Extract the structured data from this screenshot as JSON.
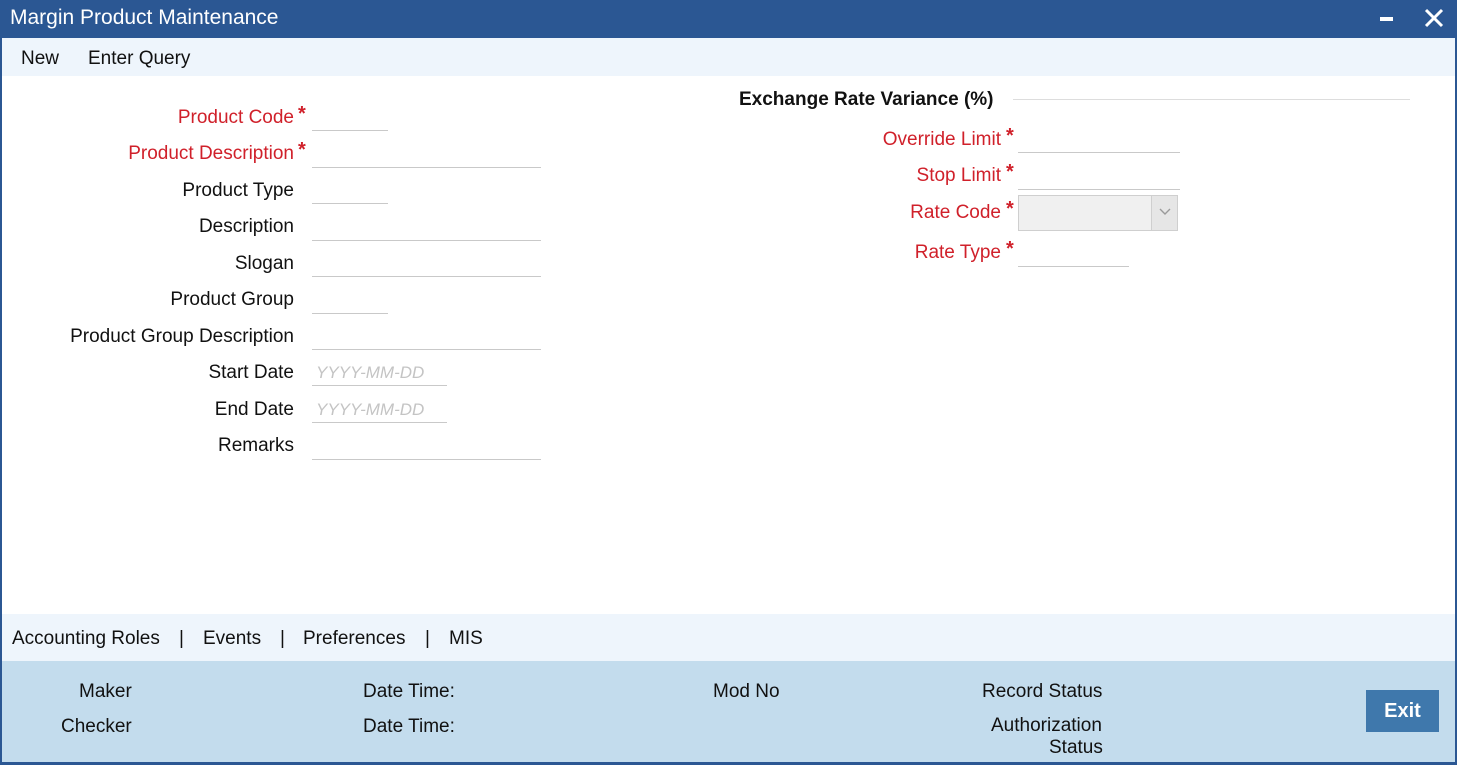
{
  "window": {
    "title": "Margin Product Maintenance",
    "controls": {
      "minimize": "minimize-icon",
      "close": "close-icon"
    },
    "accent_color": "#2b5793"
  },
  "toolbar": {
    "new_label": "New",
    "enter_query_label": "Enter Query"
  },
  "form_left": {
    "product_code": {
      "label": "Product Code",
      "required": true,
      "value": ""
    },
    "product_description": {
      "label": "Product Description",
      "required": true,
      "value": ""
    },
    "product_type": {
      "label": "Product Type",
      "value": ""
    },
    "description": {
      "label": "Description",
      "value": ""
    },
    "slogan": {
      "label": "Slogan",
      "value": ""
    },
    "product_group": {
      "label": "Product Group",
      "value": ""
    },
    "product_group_description": {
      "label": "Product Group Description",
      "value": ""
    },
    "start_date": {
      "label": "Start Date",
      "placeholder": "YYYY-MM-DD",
      "value": ""
    },
    "end_date": {
      "label": "End Date",
      "placeholder": "YYYY-MM-DD",
      "value": ""
    },
    "remarks": {
      "label": "Remarks",
      "value": ""
    }
  },
  "exchange_rate": {
    "section_title": "Exchange Rate Variance (%)",
    "override_limit": {
      "label": "Override Limit",
      "required": true,
      "value": ""
    },
    "stop_limit": {
      "label": "Stop Limit",
      "required": true,
      "value": ""
    },
    "rate_code": {
      "label": "Rate Code",
      "required": true,
      "value": ""
    },
    "rate_type": {
      "label": "Rate Type",
      "required": true,
      "value": ""
    }
  },
  "required_marker": "*",
  "tabs": [
    {
      "label": "Accounting Roles"
    },
    {
      "label": "Events"
    },
    {
      "label": "Preferences"
    },
    {
      "label": "MIS"
    }
  ],
  "tab_separator": "|",
  "footer": {
    "maker_label": "Maker",
    "checker_label": "Checker",
    "date_time_label_1": "Date Time:",
    "date_time_label_2": "Date Time:",
    "mod_no_label": "Mod No",
    "record_status_label": "Record Status",
    "authorization_status_line1": "Authorization",
    "authorization_status_line2": "Status",
    "exit_label": "Exit"
  },
  "colors": {
    "required_label": "#d0202a",
    "toolbar_bg": "#eef5fc",
    "footer_bg": "#c3dced",
    "exit_button": "#3f78ac"
  }
}
